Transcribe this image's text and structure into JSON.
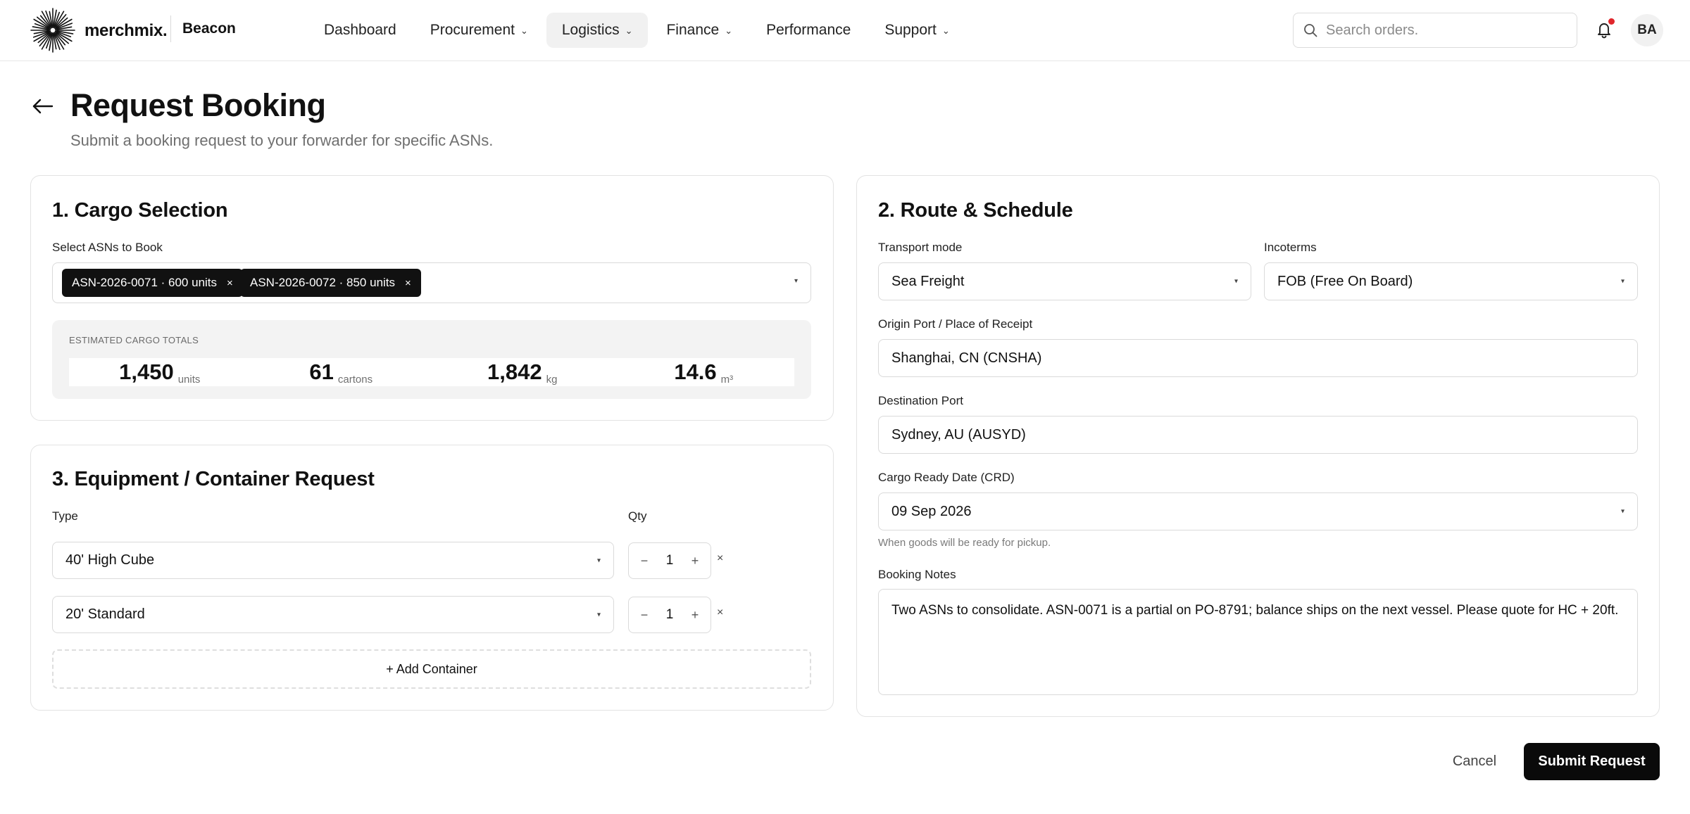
{
  "app": {
    "brand": "merchmix.",
    "workspace": "Beacon",
    "avatar_initials": "BA",
    "accent_color": "#0a0a0a",
    "notification_dot_color": "#e0262b"
  },
  "nav": {
    "items": [
      {
        "label": "Dashboard",
        "has_dropdown": false
      },
      {
        "label": "Procurement",
        "has_dropdown": true
      },
      {
        "label": "Logistics",
        "has_dropdown": true,
        "active": true
      },
      {
        "label": "Finance",
        "has_dropdown": true
      },
      {
        "label": "Performance",
        "has_dropdown": false
      },
      {
        "label": "Support",
        "has_dropdown": true
      }
    ]
  },
  "search": {
    "placeholder": "Search orders."
  },
  "page": {
    "title": "Request Booking",
    "subtitle": "Submit a booking request to your forwarder for specific ASNs."
  },
  "cargo": {
    "title": "1. Cargo Selection",
    "asn_label": "Select ASNs to Book",
    "selected_asns": [
      "ASN-2026-0071 · 600 units",
      "ASN-2026-0072 · 850 units"
    ],
    "totals_label": "ESTIMATED CARGO TOTALS",
    "totals": [
      {
        "value": "1,450",
        "unit": "units"
      },
      {
        "value": "61",
        "unit": "cartons"
      },
      {
        "value": "1,842",
        "unit": "kg"
      },
      {
        "value": "14.6",
        "unit": "m³"
      }
    ]
  },
  "equipment": {
    "title": "3. Equipment / Container Request",
    "type_label": "Type",
    "qty_label": "Qty",
    "rows": [
      {
        "type": "40' High Cube",
        "qty": "1"
      },
      {
        "type": "20' Standard",
        "qty": "1"
      }
    ],
    "add_label": "+ Add Container"
  },
  "route": {
    "title": "2. Route & Schedule",
    "transport_mode_label": "Transport mode",
    "transport_mode": "Sea Freight",
    "incoterms_label": "Incoterms",
    "incoterms": "FOB (Free On Board)",
    "origin_label": "Origin Port / Place of Receipt",
    "origin": "Shanghai, CN (CNSHA)",
    "destination_label": "Destination Port",
    "destination": "Sydney, AU (AUSYD)",
    "crd_label": "Cargo Ready Date (CRD)",
    "crd": "09 Sep 2026",
    "crd_hint": "When goods will be ready for pickup.",
    "notes_label": "Booking Notes",
    "notes": "Two ASNs to consolidate. ASN-0071 is a partial on PO-8791; balance ships on the next vessel. Please quote for HC + 20ft."
  },
  "footer": {
    "cancel_label": "Cancel",
    "submit_label": "Submit Request"
  },
  "icons": {
    "logo": "starburst-logo-icon",
    "search": "search-icon",
    "bell": "bell-icon",
    "back": "arrow-left-icon",
    "caret": "caret-down-icon",
    "chevron": "chevron-down-icon",
    "close": "close-icon",
    "minus": "minus-icon",
    "plus": "plus-icon"
  },
  "glyphs": {
    "chevron": "⌄",
    "caret": "▾",
    "close": "×",
    "minus": "−",
    "plus": "+"
  }
}
